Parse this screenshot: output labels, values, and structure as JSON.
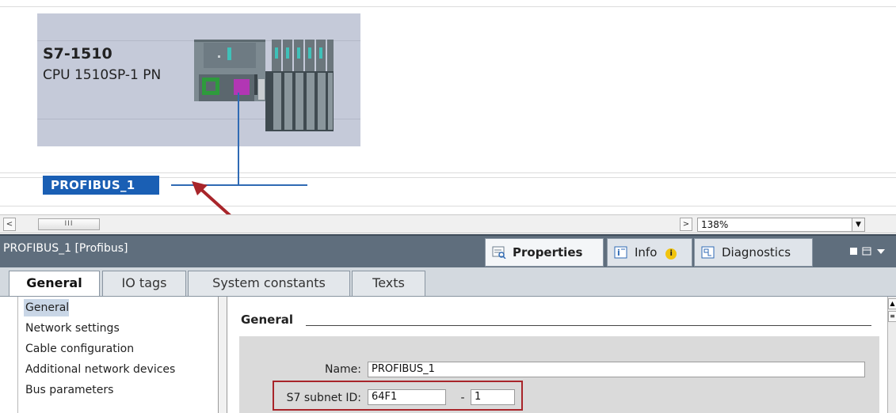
{
  "device": {
    "name": "S7-1510",
    "type": "CPU 1510SP-1 PN"
  },
  "network": {
    "subnet_label": "PROFIBUS_1"
  },
  "scrollbar": {
    "left_arrow": "<",
    "thumb_grip": "III",
    "right_arrow": ">",
    "zoom_value": "138%",
    "dropdown_arrow": "▼"
  },
  "inspector": {
    "title": "PROFIBUS_1 [Profibus]",
    "tabs": [
      {
        "label": "Properties",
        "icon": "properties-icon"
      },
      {
        "label": "Info",
        "icon": "info-icon"
      },
      {
        "label": "Diagnostics",
        "icon": "diagnostics-icon"
      }
    ],
    "info_badge": "i",
    "subtabs": [
      "General",
      "IO tags",
      "System constants",
      "Texts"
    ],
    "nav": [
      "General",
      "Network settings",
      "Cable configuration",
      "Additional network devices",
      "Bus parameters"
    ],
    "section_title": "General",
    "fields": {
      "name_label": "Name:",
      "name_value": "PROFIBUS_1",
      "subnet_label": "S7 subnet ID:",
      "subnet_value": "64F1",
      "subnet_sep": "-",
      "subnet_suffix": "1"
    }
  },
  "colors": {
    "subnet_accent": "#1a5fb4",
    "annotation_red": "#a8252a",
    "device_bg": "#c5cad9"
  }
}
